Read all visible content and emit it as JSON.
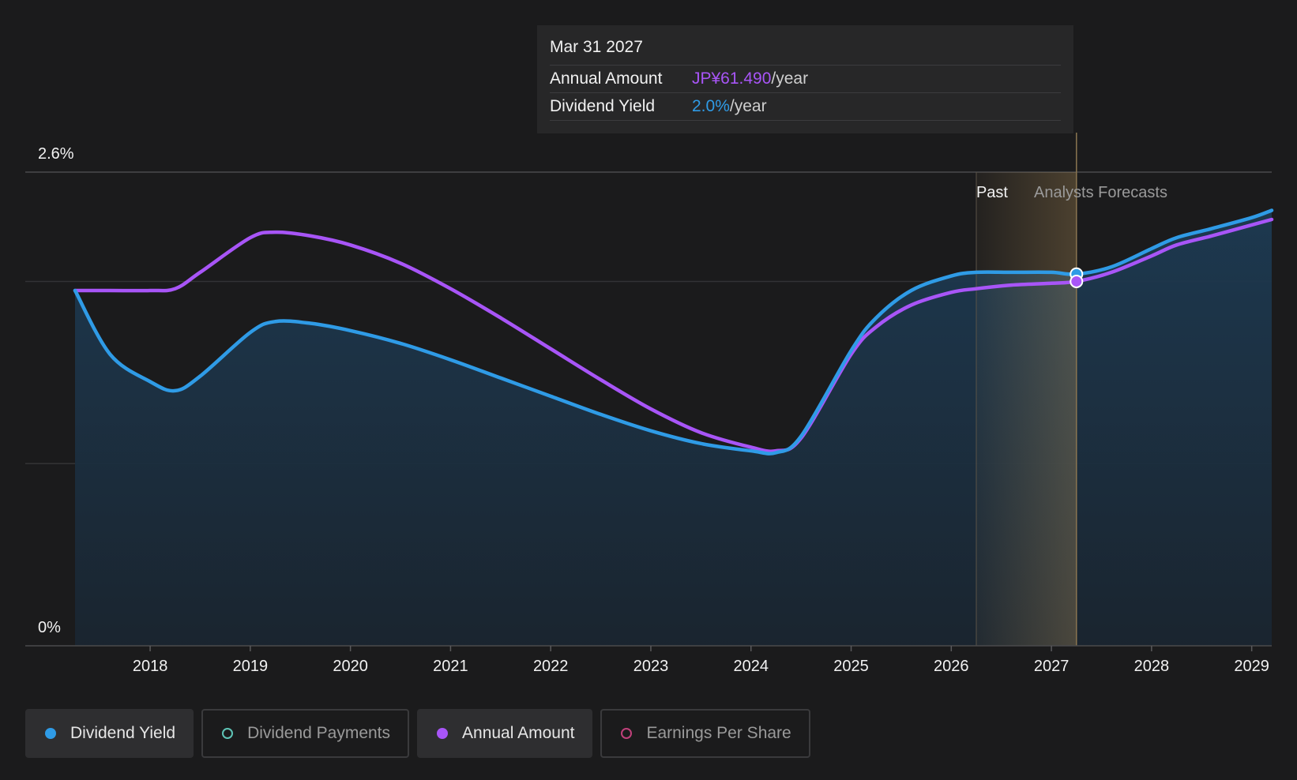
{
  "tooltip": {
    "date": "Mar 31 2027",
    "rows": [
      {
        "label": "Annual Amount",
        "value": "JP¥61.490",
        "unit": "/year"
      },
      {
        "label": "Dividend Yield",
        "value": "2.0%",
        "unit": "/year"
      }
    ]
  },
  "region_labels": {
    "past": "Past",
    "forecast": "Analysts Forecasts"
  },
  "legend": [
    {
      "label": "Dividend Yield",
      "color": "#2f9be6",
      "active": true
    },
    {
      "label": "Dividend Payments",
      "color": "#5ec4b6",
      "active": false
    },
    {
      "label": "Annual Amount",
      "color": "#a855f7",
      "active": true
    },
    {
      "label": "Earnings Per Share",
      "color": "#c0407a",
      "active": false
    }
  ],
  "chart_data": {
    "type": "line",
    "y_tick_labels": [
      "2.6%",
      "0%"
    ],
    "ylim": [
      0,
      2.6
    ],
    "xlim": [
      2017.25,
      2029.2
    ],
    "x_ticks": [
      2018,
      2019,
      2020,
      2021,
      2022,
      2023,
      2024,
      2025,
      2026,
      2027,
      2028,
      2029
    ],
    "x_tick_labels": [
      "2018",
      "2019",
      "2020",
      "2021",
      "2022",
      "2023",
      "2024",
      "2025",
      "2026",
      "2027",
      "2028",
      "2029"
    ],
    "past_start": 2026.25,
    "highlight_x": 2027.25,
    "series": [
      {
        "name": "Dividend Yield",
        "color": "#2f9be6",
        "area": true,
        "x": [
          2017.25,
          2017.6,
          2018.0,
          2018.25,
          2018.5,
          2019.0,
          2019.25,
          2019.6,
          2020.0,
          2020.5,
          2021.0,
          2021.5,
          2022.0,
          2022.5,
          2023.0,
          2023.5,
          2024.0,
          2024.25,
          2024.5,
          2025.0,
          2025.25,
          2025.6,
          2026.0,
          2026.25,
          2026.6,
          2027.0,
          2027.25,
          2027.6,
          2028.0,
          2028.25,
          2028.6,
          2029.0,
          2029.2
        ],
        "y": [
          1.95,
          1.6,
          1.45,
          1.4,
          1.48,
          1.72,
          1.78,
          1.77,
          1.73,
          1.66,
          1.57,
          1.47,
          1.37,
          1.27,
          1.18,
          1.11,
          1.07,
          1.06,
          1.15,
          1.62,
          1.8,
          1.95,
          2.03,
          2.05,
          2.05,
          2.05,
          2.04,
          2.08,
          2.18,
          2.24,
          2.29,
          2.35,
          2.39
        ]
      },
      {
        "name": "Annual Amount",
        "color": "#a855f7",
        "area": false,
        "x": [
          2017.25,
          2017.6,
          2018.0,
          2018.25,
          2018.5,
          2019.0,
          2019.25,
          2019.6,
          2020.0,
          2020.5,
          2021.0,
          2021.5,
          2022.0,
          2022.5,
          2023.0,
          2023.5,
          2024.0,
          2024.25,
          2024.5,
          2025.0,
          2025.25,
          2025.6,
          2026.0,
          2026.25,
          2026.6,
          2027.0,
          2027.25,
          2027.6,
          2028.0,
          2028.25,
          2028.6,
          2029.0,
          2029.2
        ],
        "y": [
          1.95,
          1.95,
          1.95,
          1.96,
          2.05,
          2.24,
          2.27,
          2.25,
          2.2,
          2.1,
          1.96,
          1.8,
          1.63,
          1.46,
          1.3,
          1.17,
          1.09,
          1.07,
          1.14,
          1.6,
          1.75,
          1.87,
          1.94,
          1.96,
          1.98,
          1.99,
          2.0,
          2.05,
          2.14,
          2.2,
          2.25,
          2.31,
          2.34
        ]
      }
    ]
  }
}
